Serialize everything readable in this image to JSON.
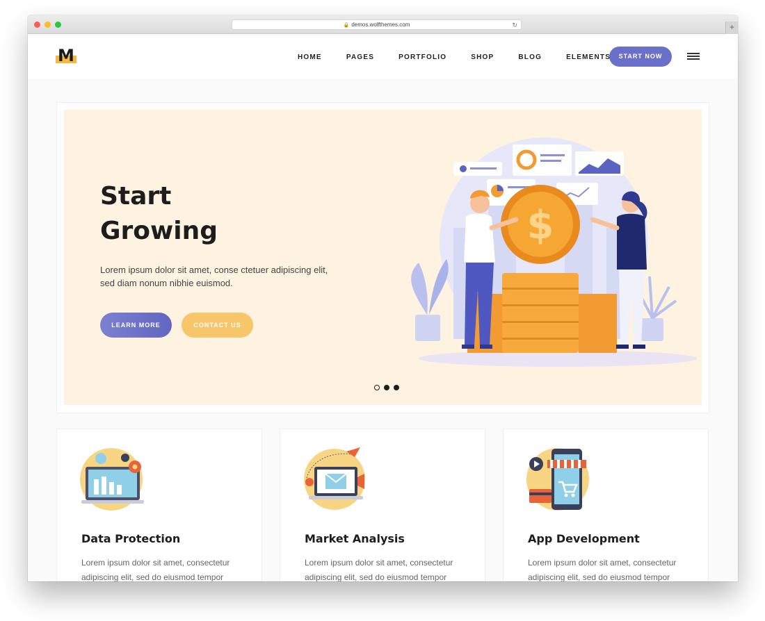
{
  "browser": {
    "url": "demos.wolfthemes.com"
  },
  "header": {
    "logo_letter": "M",
    "nav": [
      "HOME",
      "PAGES",
      "PORTFOLIO",
      "SHOP",
      "BLOG",
      "ELEMENTS"
    ],
    "cta_label": "START NOW"
  },
  "hero": {
    "title_line1": "Start",
    "title_line2": "Growing",
    "text": "Lorem ipsum dolor sit amet, conse ctetuer adipiscing elit, sed diam nonum nibhie euismod.",
    "learn_more": "LEARN MORE",
    "contact_us": "CONTACT US",
    "slide_count": 3,
    "active_slide": 1
  },
  "features": [
    {
      "title": "Data Protection",
      "text": "Lorem ipsum dolor sit amet, consectetur adipiscing elit, sed do eiusmod tempor",
      "icon": "laptop-chart-icon"
    },
    {
      "title": "Market Analysis",
      "text": "Lorem ipsum dolor sit amet, consectetur adipiscing elit, sed do eiusmod tempor",
      "icon": "laptop-email-icon"
    },
    {
      "title": "App Development",
      "text": "Lorem ipsum dolor sit amet, consectetur adipiscing elit, sed do eiusmod tempor",
      "icon": "mobile-shop-icon"
    }
  ],
  "colors": {
    "accent": "#6a70c9",
    "yellow": "#f6b93f",
    "hero_bg": "#fdf3e0"
  }
}
